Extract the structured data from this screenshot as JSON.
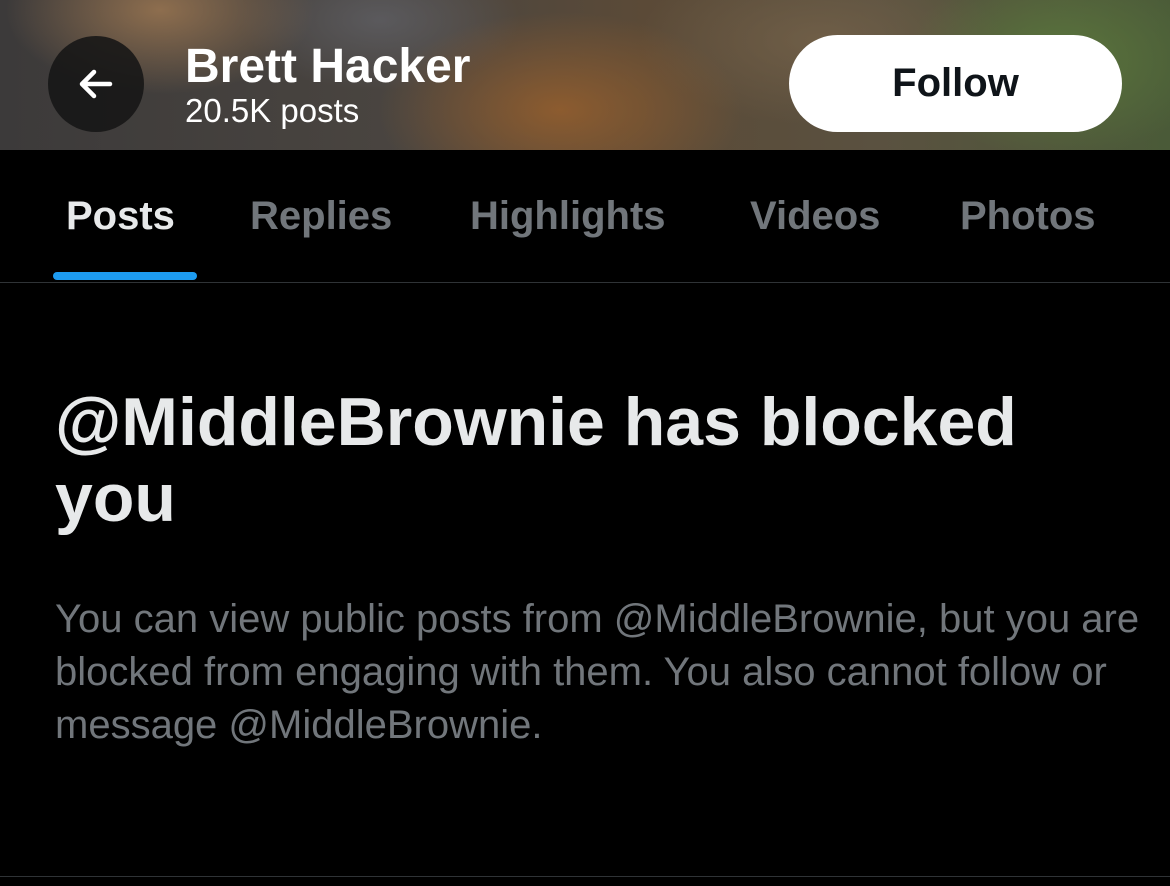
{
  "header": {
    "profile_name": "Brett Hacker",
    "post_count": "20.5K posts",
    "back_icon": "arrow-left-icon",
    "follow_label": "Follow"
  },
  "tabs": [
    {
      "label": "Posts",
      "active": true
    },
    {
      "label": "Replies",
      "active": false
    },
    {
      "label": "Highlights",
      "active": false
    },
    {
      "label": "Videos",
      "active": false
    },
    {
      "label": "Photos",
      "active": false
    }
  ],
  "blocked": {
    "title": "@MiddleBrownie has blocked you",
    "description": "You can view public posts from @MiddleBrownie, but you are blocked from engaging with them. You also cannot follow or message @MiddleBrownie."
  },
  "colors": {
    "background": "#000000",
    "primary_text": "#e7e9ea",
    "secondary_text": "#71767b",
    "accent": "#1d9bf0",
    "follow_button_bg": "#ffffff"
  }
}
